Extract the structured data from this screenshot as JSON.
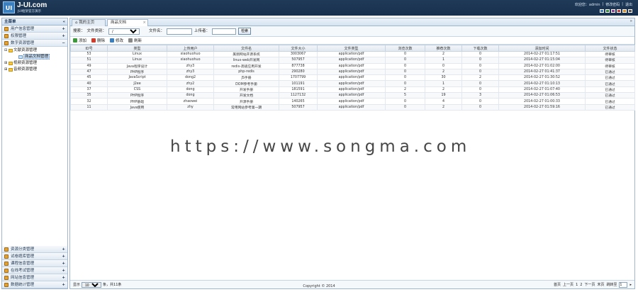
{
  "header": {
    "logo_mark": "UI",
    "title": "J-UI.com",
    "subtitle": "JUI框架官方演示",
    "links": [
      "欢迎您：admin",
      "|",
      "修改密码",
      "|",
      "退出"
    ],
    "theme_colors": [
      "#3a7fc0",
      "#2f8f3a",
      "#8a3c9c",
      "#c73a3a",
      "#d98a1f",
      "#555555"
    ]
  },
  "sidebar": {
    "title": "主菜单",
    "collapse_icon": "«",
    "top_groups": [
      {
        "label": "用户信息管理",
        "toggle": "+"
      },
      {
        "label": "权限管理",
        "toggle": "+"
      },
      {
        "label": "数字资源管理",
        "toggle": "−"
      }
    ],
    "tree": [
      {
        "label": "文献资源管理",
        "level": 0,
        "toggle": "⊟",
        "selected": false
      },
      {
        "label": "商品文档管理",
        "level": 1,
        "toggle": "",
        "selected": true
      },
      {
        "label": "视频资源管理",
        "level": 0,
        "toggle": "⊞",
        "selected": false
      },
      {
        "label": "音频资源管理",
        "level": 0,
        "toggle": "⊞",
        "selected": false
      }
    ],
    "bottom_groups": [
      {
        "label": "资源分类管理",
        "toggle": "+"
      },
      {
        "label": "试卷题库管理",
        "toggle": "+"
      },
      {
        "label": "课程信息管理",
        "toggle": "+"
      },
      {
        "label": "在线考试管理",
        "toggle": "+"
      },
      {
        "label": "网站信息管理",
        "toggle": "+"
      },
      {
        "label": "数据统计管理",
        "toggle": "+"
      }
    ]
  },
  "tabs": [
    {
      "label": "我的主页",
      "active": false
    },
    {
      "label": "商品文档",
      "active": true,
      "close": "×"
    }
  ],
  "tabs_nav": "»",
  "search": {
    "keyword_label": "搜索：",
    "type_label": "文件类别：",
    "type_value": "/",
    "filename_label": "文件名：",
    "uploader_label": "上传者：",
    "button": "检索"
  },
  "toolbar": [
    {
      "label": "添加",
      "color": "#3a9a3a"
    },
    {
      "label": "删除",
      "color": "#d23a2a"
    },
    {
      "label": "修改",
      "color": "#3a7fc0"
    },
    {
      "label": "刷新",
      "color": "#888888"
    }
  ],
  "table": {
    "columns": [
      "ID号",
      "类型",
      "上传用户",
      "文件名",
      "文件大小",
      "文件类型",
      "浏览次数",
      "推荐次数",
      "下载次数",
      "添加时间",
      "文件状态"
    ],
    "rows": [
      [
        "53",
        "Linux",
        "xiaohuohuo",
        "美丽网站开源系统",
        "3003067",
        "application/pdf",
        "0",
        "2",
        "0",
        "2014-02-27 01:17:51",
        "待审核"
      ],
      [
        "51",
        "Linux",
        "xiaohuohuo",
        "linux-web开发网",
        "507957",
        "application/pdf",
        "0",
        "1",
        "0",
        "2014-02-27 01:15:04",
        "待审核"
      ],
      [
        "49",
        "Java程序设计",
        "zhy3",
        "redis-高级应用开发",
        "877738",
        "application/pdf",
        "0",
        "0",
        "0",
        "2014-02-27 01:02:00",
        "待审核"
      ],
      [
        "47",
        "PHP程序",
        "zhy3",
        "php-redis",
        "290280",
        "application/pdf",
        "0",
        "2",
        "0",
        "2014-02-27 01:41:37",
        "已通过"
      ],
      [
        "45",
        "JavaScript",
        "dong2",
        "JS手册",
        "1707799",
        "application/pdf",
        "0",
        "30",
        "2",
        "2014-02-27 01:30:52",
        "已通过"
      ],
      [
        "40",
        "J2ee",
        "zhy2",
        "DOM参考手册",
        "101191",
        "application/pdf",
        "0",
        "1",
        "0",
        "2014-02-27 01:10:13",
        "已通过"
      ],
      [
        "37",
        "CSS",
        "dong",
        "开发手册",
        "181591",
        "application/pdf",
        "2",
        "2",
        "0",
        "2014-02-27 01:07:40",
        "已通过"
      ],
      [
        "35",
        "PHP程序",
        "dong",
        "开发文档",
        "1127132",
        "application/pdf",
        "5",
        "19",
        "3",
        "2014-02-27 01:06:53",
        "已通过"
      ],
      [
        "32",
        "PHP基础",
        "zhaowei",
        "开源手册",
        "140265",
        "application/pdf",
        "0",
        "4",
        "0",
        "2014-02-27 01:00:33",
        "已通过"
      ],
      [
        "11",
        "Java使用",
        "zhy",
        "常用网站参考第一期",
        "507957",
        "application/pdf",
        "0",
        "2",
        "0",
        "2014-02-27 01:59:16",
        "已通过"
      ]
    ]
  },
  "pager": {
    "show_label": "显示",
    "page_size": "10",
    "total_label": "条，共11条",
    "nav": [
      "首页",
      "上一页",
      "1",
      "2",
      "下一页",
      "末页"
    ],
    "jump_label": "跳转至",
    "page_value": "1",
    "go": "▸"
  },
  "footer": "Copyright © 2014",
  "watermark": "https://www.songma.com"
}
